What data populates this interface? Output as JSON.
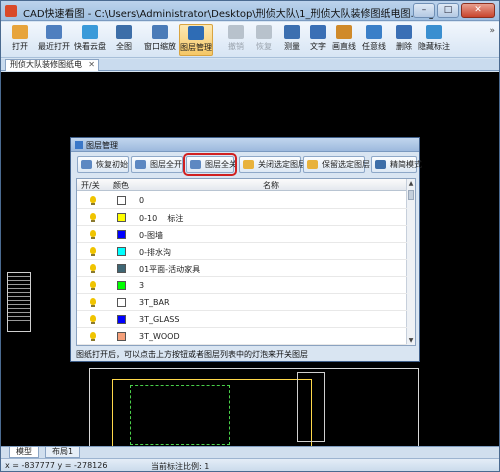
{
  "window": {
    "title": "CAD快速看图 - C:\\Users\\Administrator\\Desktop\\刑侦大队\\1_刑侦大队装修图纸电图.dwg",
    "controls": [
      "–",
      "□",
      "✕"
    ]
  },
  "toolbar": {
    "items": [
      {
        "label": "打开",
        "icon": "folder-open-icon",
        "color": "#e7a43c",
        "state": "normal"
      },
      {
        "label": "最近打开",
        "icon": "recent-files-icon",
        "color": "#4f7fbf",
        "state": "normal"
      },
      {
        "label": "快看云盘",
        "icon": "cloud-icon",
        "color": "#3a9ad9",
        "state": "normal"
      },
      {
        "label": "全图",
        "icon": "fit-screen-icon",
        "color": "#3d6ea8",
        "state": "normal"
      },
      {
        "label": "窗口缩放",
        "icon": "zoom-window-icon",
        "color": "#4a7bb8",
        "state": "normal"
      },
      {
        "label": "图层管理",
        "icon": "layers-icon",
        "color": "#2e6cb5",
        "state": "active"
      },
      {
        "label": "撤销",
        "icon": "undo-icon",
        "color": "#b8c2cc",
        "state": "disabled"
      },
      {
        "label": "恢复",
        "icon": "redo-icon",
        "color": "#b8c2cc",
        "state": "disabled"
      },
      {
        "label": "测量",
        "icon": "measure-icon",
        "color": "#3c6fb0",
        "state": "normal"
      },
      {
        "label": "文字",
        "icon": "text-icon",
        "color": "#3a6fb5",
        "state": "normal"
      },
      {
        "label": "画直线",
        "icon": "line-icon",
        "color": "#d08a2a",
        "state": "normal"
      },
      {
        "label": "任意线",
        "icon": "freehand-icon",
        "color": "#3a7fc8",
        "state": "normal"
      },
      {
        "label": "删除",
        "icon": "eraser-icon",
        "color": "#3a6fb5",
        "state": "normal"
      },
      {
        "label": "隐藏标注",
        "icon": "hide-annotation-icon",
        "color": "#3a8fd0",
        "state": "normal"
      }
    ],
    "overflow": "»"
  },
  "doc_tab": {
    "label": "刑侦大队装修图纸电",
    "close": "✕"
  },
  "layer_dialog": {
    "title": "图层管理",
    "buttons": [
      {
        "label": "恢复初始",
        "name": "restore-default-button"
      },
      {
        "label": "图层全开",
        "name": "all-layers-on-button"
      },
      {
        "label": "图层全关",
        "name": "all-layers-off-button"
      },
      {
        "label": "关闭选定图层",
        "name": "close-selected-layer-button"
      },
      {
        "label": "保留选定图层",
        "name": "keep-selected-layer-button"
      },
      {
        "label": "精简模式",
        "name": "simple-mode-button"
      }
    ],
    "columns": {
      "toggle": "开/关",
      "color": "颜色",
      "name": "名称"
    },
    "rows": [
      {
        "color": "#ffffff",
        "name": "0"
      },
      {
        "color": "#ffff00",
        "name": "0-10    标注"
      },
      {
        "color": "#0000ff",
        "name": "0-图墙"
      },
      {
        "color": "#00ffff",
        "name": "0-排水沟"
      },
      {
        "color": "#3f6674",
        "name": "01平面-活动家具"
      },
      {
        "color": "#00ff00",
        "name": "3"
      },
      {
        "color": "#ffffff",
        "name": "3T_BAR"
      },
      {
        "color": "#0000ff",
        "name": "3T_GLASS"
      },
      {
        "color": "#f5a07a",
        "name": "3T_WOOD"
      }
    ],
    "hint": "图纸打开后，可以点击上方按钮或者图层列表中的灯泡来开关图层"
  },
  "bottom_tabs": [
    {
      "label": "模型",
      "active": true
    },
    {
      "label": "布局1",
      "active": false
    }
  ],
  "statusbar": {
    "coords": "x = -837777  y = -278126",
    "scale": "当前标注比例: 1"
  }
}
